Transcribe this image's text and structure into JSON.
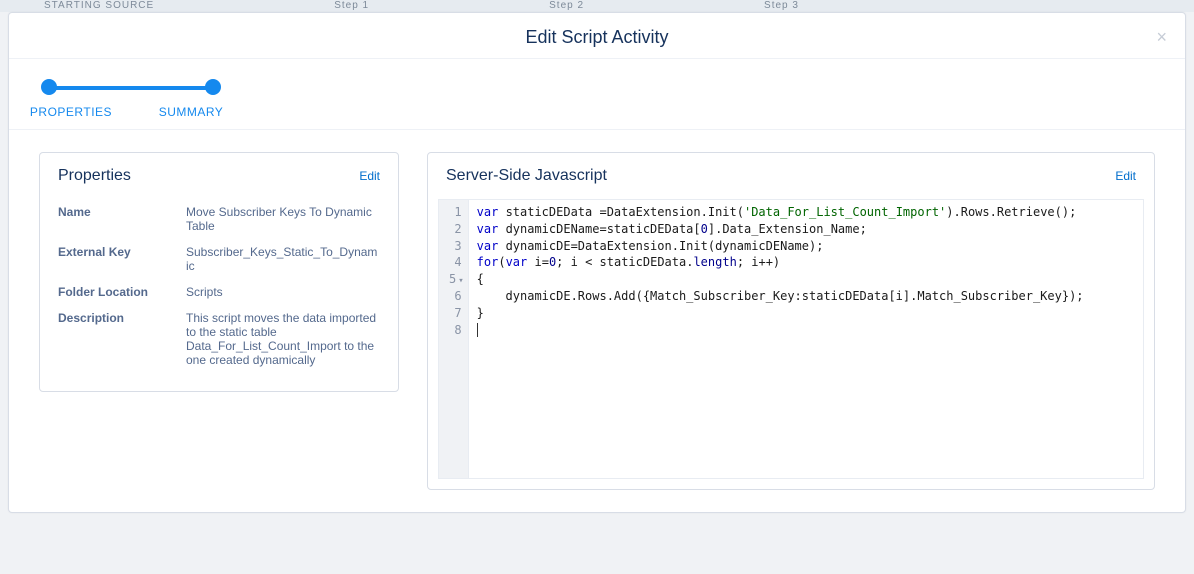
{
  "background": {
    "starting_source": "STARTING SOURCE",
    "step1": "Step 1",
    "step2": "Step 2",
    "step3": "Step 3"
  },
  "modal": {
    "title": "Edit Script Activity",
    "close": "×"
  },
  "stepper": {
    "labels": [
      "PROPERTIES",
      "SUMMARY"
    ]
  },
  "properties_panel": {
    "title": "Properties",
    "edit": "Edit",
    "rows": [
      {
        "k": "Name",
        "v": "Move Subscriber Keys To Dynamic Table"
      },
      {
        "k": "External Key",
        "v": "Subscriber_Keys_Static_To_Dynamic"
      },
      {
        "k": "Folder Location",
        "v": "Scripts"
      },
      {
        "k": "Description",
        "v": "This script moves the data imported to the static table Data_For_List_Count_Import to the one created dynamically"
      }
    ]
  },
  "code_panel": {
    "title": "Server-Side Javascript",
    "edit": "Edit",
    "line_numbers": [
      "1",
      "2",
      "3",
      "4",
      "5",
      "6",
      "7",
      "8"
    ],
    "fold_line_index": 4,
    "tokens": [
      [
        {
          "t": "var ",
          "c": "kw"
        },
        {
          "t": "staticDEData =DataExtension.Init(",
          "c": "plain"
        },
        {
          "t": "'Data_For_List_Count_Import'",
          "c": "str"
        },
        {
          "t": ").Rows.Retrieve();",
          "c": "plain"
        }
      ],
      [
        {
          "t": "var ",
          "c": "kw"
        },
        {
          "t": "dynamicDEName=staticDEData[",
          "c": "plain"
        },
        {
          "t": "0",
          "c": "prop"
        },
        {
          "t": "].Data_Extension_Name;",
          "c": "plain"
        }
      ],
      [
        {
          "t": "var ",
          "c": "kw"
        },
        {
          "t": "dynamicDE=DataExtension.Init(dynamicDEName);",
          "c": "plain"
        }
      ],
      [
        {
          "t": "for",
          "c": "kw"
        },
        {
          "t": "(",
          "c": "plain"
        },
        {
          "t": "var ",
          "c": "kw"
        },
        {
          "t": "i=",
          "c": "plain"
        },
        {
          "t": "0",
          "c": "prop"
        },
        {
          "t": "; i < staticDEData.",
          "c": "plain"
        },
        {
          "t": "length",
          "c": "prop"
        },
        {
          "t": "; i++)",
          "c": "plain"
        }
      ],
      [
        {
          "t": "{",
          "c": "plain"
        }
      ],
      [
        {
          "t": "    dynamicDE.Rows.Add({Match_Subscriber_Key:staticDEData[i].Match_Subscriber_Key});",
          "c": "plain"
        }
      ],
      [
        {
          "t": "}",
          "c": "plain"
        }
      ],
      [
        {
          "t": "",
          "c": "plain",
          "cursor": true
        }
      ]
    ]
  }
}
